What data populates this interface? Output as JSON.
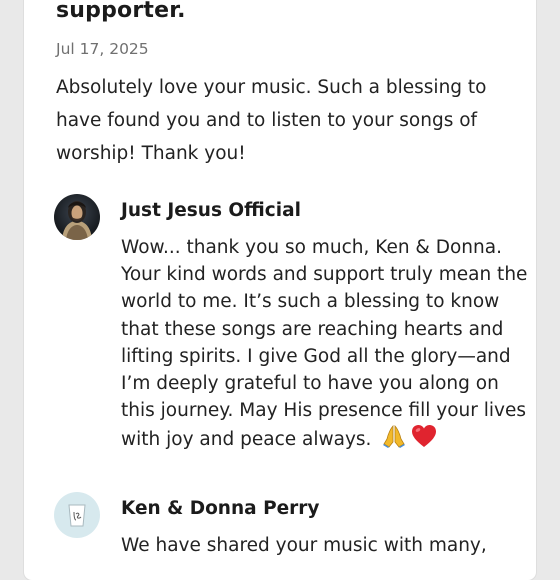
{
  "post": {
    "title": "supporter.",
    "date": "Jul 17, 2025",
    "body": "Absolutely love your music. Such a blessing to have found you and to listen to your songs of worship! Thank you!"
  },
  "replies": [
    {
      "author": "Just Jesus Official",
      "avatar_icon": "artist-portrait-avatar",
      "text": "Wow... thank you so much, Ken & Donna. Your kind words and support truly mean the world to me. It’s such a blessing to know that these songs are reaching hearts and lifting spirits. I give God all the glory—and I’m deeply grateful to have you along on this journey. May His presence fill your lives with joy and peace always.",
      "emojis": [
        "praying-hands-icon",
        "red-heart-icon"
      ]
    },
    {
      "author": "Ken & Donna Perry",
      "avatar_icon": "monogram-cup-avatar",
      "text": "We have shared your music with many,"
    }
  ],
  "colors": {
    "background": "#e9e9e9",
    "card": "#ffffff",
    "text": "#1b1b1b",
    "date": "#707070",
    "fan_avatar_bg": "#d7e9ee",
    "heart": "#e0242f",
    "hands": "#f2b92a"
  }
}
